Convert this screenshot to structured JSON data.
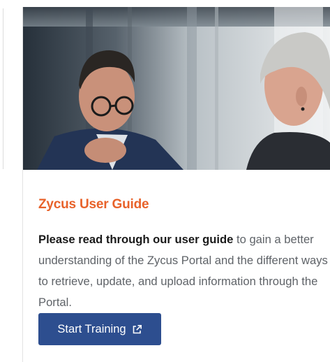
{
  "colors": {
    "accent": "#e8622a",
    "button_bg": "#2d4e8f",
    "body_text": "#5f6368",
    "strong_text": "#1a1a1a"
  },
  "card": {
    "image_alt": "",
    "title": "Zycus User Guide",
    "body_strong": "Please read through our user guide",
    "body_rest": " to gain a better understanding of the Zycus Portal and the different ways to retrieve, update, and upload information through the Portal.",
    "cta_label": "Start Training",
    "cta_icon": "external-link-icon"
  }
}
